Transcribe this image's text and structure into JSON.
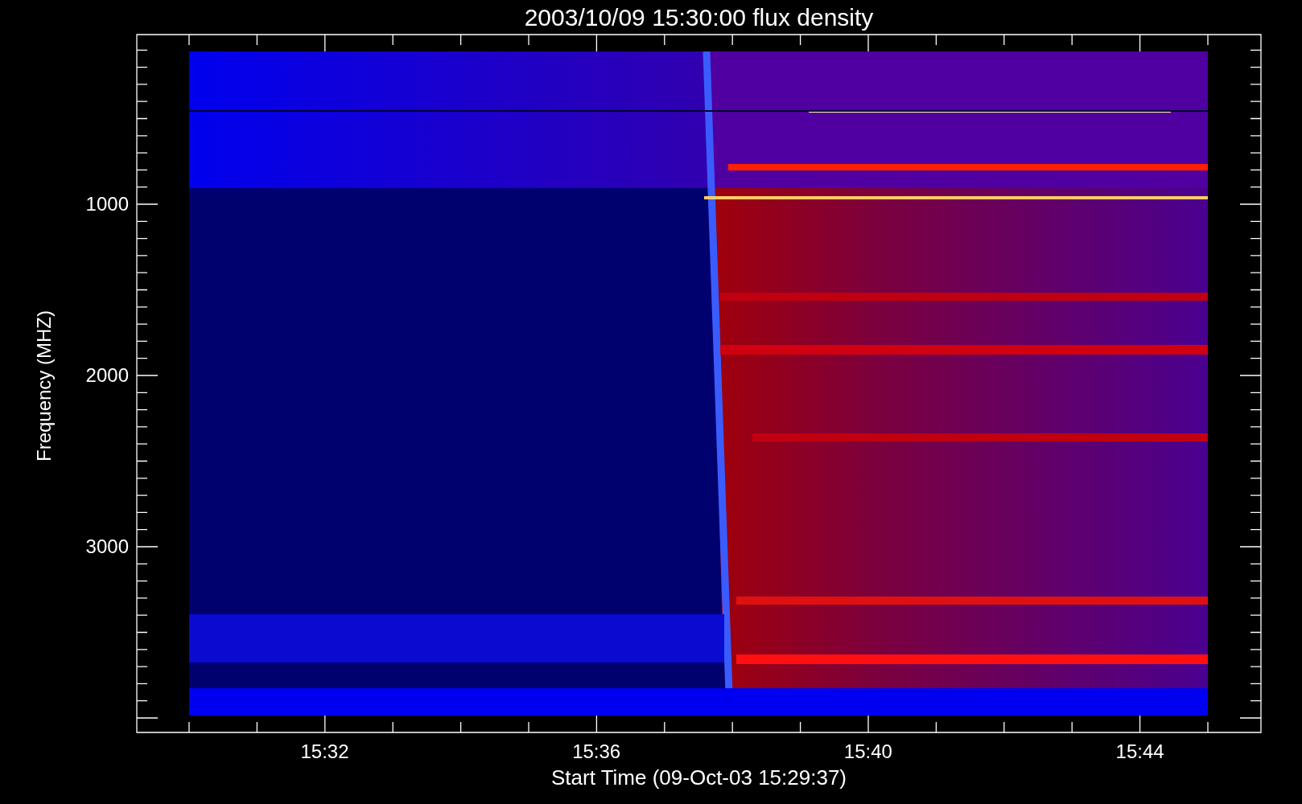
{
  "title": "2003/10/09 15:30:00 flux density",
  "y_axis": {
    "label": "Frequency (MHZ)",
    "ticks": [
      "1000",
      "2000",
      "3000"
    ]
  },
  "x_axis": {
    "label": "Start Time (09-Oct-03 15:29:37)",
    "ticks": [
      "15:32",
      "15:36",
      "15:40",
      "15:44"
    ]
  }
}
